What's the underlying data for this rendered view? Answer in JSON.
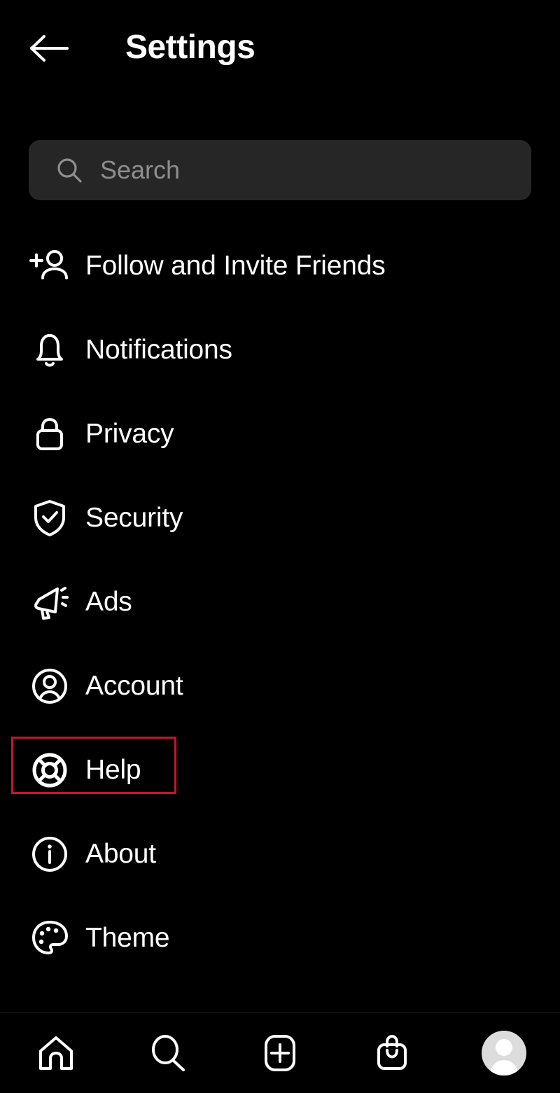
{
  "app": {
    "background_color": "#000000",
    "accent_highlight_color": "#c4152c"
  },
  "header": {
    "back_icon": "arrow-left-icon",
    "title": "Settings"
  },
  "search": {
    "icon": "search-icon",
    "placeholder": "Search",
    "value": ""
  },
  "menu": {
    "items": [
      {
        "label": "Follow and Invite Friends",
        "icon": "person-add-icon",
        "highlighted": false
      },
      {
        "label": "Notifications",
        "icon": "bell-icon",
        "highlighted": false
      },
      {
        "label": "Privacy",
        "icon": "lock-icon",
        "highlighted": false
      },
      {
        "label": "Security",
        "icon": "shield-check-icon",
        "highlighted": false
      },
      {
        "label": "Ads",
        "icon": "megaphone-icon",
        "highlighted": false
      },
      {
        "label": "Account",
        "icon": "account-circle-icon",
        "highlighted": false
      },
      {
        "label": "Help",
        "icon": "life-ring-icon",
        "highlighted": true
      },
      {
        "label": "About",
        "icon": "info-circle-icon",
        "highlighted": false
      },
      {
        "label": "Theme",
        "icon": "palette-icon",
        "highlighted": false
      }
    ]
  },
  "bottom_nav": {
    "items": [
      {
        "name": "home",
        "icon": "home-icon"
      },
      {
        "name": "search",
        "icon": "search-icon"
      },
      {
        "name": "create",
        "icon": "plus-square-icon"
      },
      {
        "name": "shop",
        "icon": "shopping-bag-icon"
      },
      {
        "name": "profile",
        "icon": "avatar-icon"
      }
    ]
  }
}
